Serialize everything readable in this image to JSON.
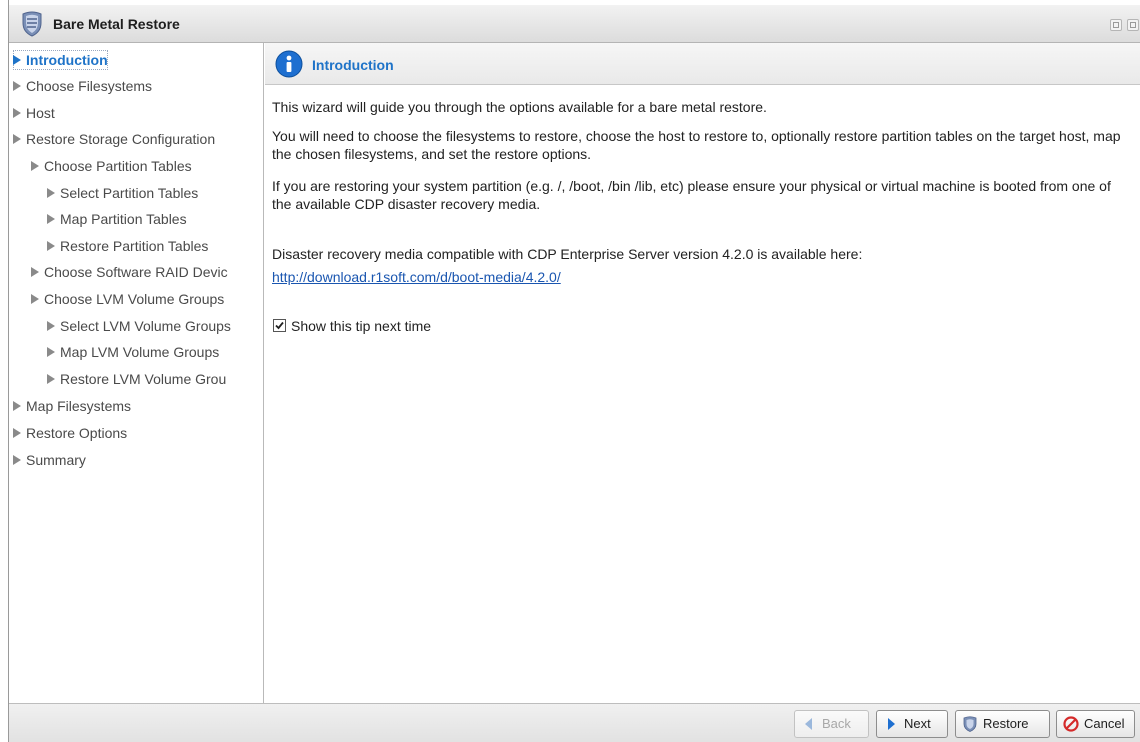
{
  "window": {
    "title": "Bare Metal Restore"
  },
  "sidebar": {
    "items": [
      {
        "label": "Introduction",
        "active": true
      },
      {
        "label": "Choose Filesystems"
      },
      {
        "label": "Host"
      },
      {
        "label": "Restore Storage Configuration"
      },
      {
        "label": "Choose Partition Tables"
      },
      {
        "label": "Select Partition Tables"
      },
      {
        "label": "Map Partition Tables"
      },
      {
        "label": "Restore Partition Tables"
      },
      {
        "label": "Choose Software RAID Devic"
      },
      {
        "label": "Choose LVM Volume Groups"
      },
      {
        "label": "Select LVM Volume Groups"
      },
      {
        "label": "Map LVM Volume Groups"
      },
      {
        "label": "Restore LVM Volume Grou"
      },
      {
        "label": "Map Filesystems"
      },
      {
        "label": "Restore Options"
      },
      {
        "label": "Summary"
      }
    ]
  },
  "main": {
    "header_title": "Introduction",
    "paragraph1": "This wizard will guide you through the options available for a bare metal restore.",
    "paragraph2": "You will need to choose the filesystems to restore, choose the host to restore to, optionally restore partition tables on the target host, map the chosen filesystems, and set the restore options.",
    "paragraph3": "If you are restoring your system partition (e.g. /, /boot, /bin /lib, etc) please ensure your physical or virtual machine is booted from one of the available CDP disaster recovery media.",
    "paragraph4": "Disaster recovery media compatible with CDP Enterprise Server version 4.2.0 is available here:",
    "download_link": "http://download.r1soft.com/d/boot-media/4.2.0/",
    "show_tip_label": "Show this tip next time",
    "show_tip_checked": true
  },
  "footer": {
    "back_label": "Back",
    "next_label": "Next",
    "restore_label": "Restore",
    "cancel_label": "Cancel"
  },
  "colors": {
    "accent": "#1e73c8",
    "link": "#1a56b0",
    "cancel": "#d42a2a"
  }
}
